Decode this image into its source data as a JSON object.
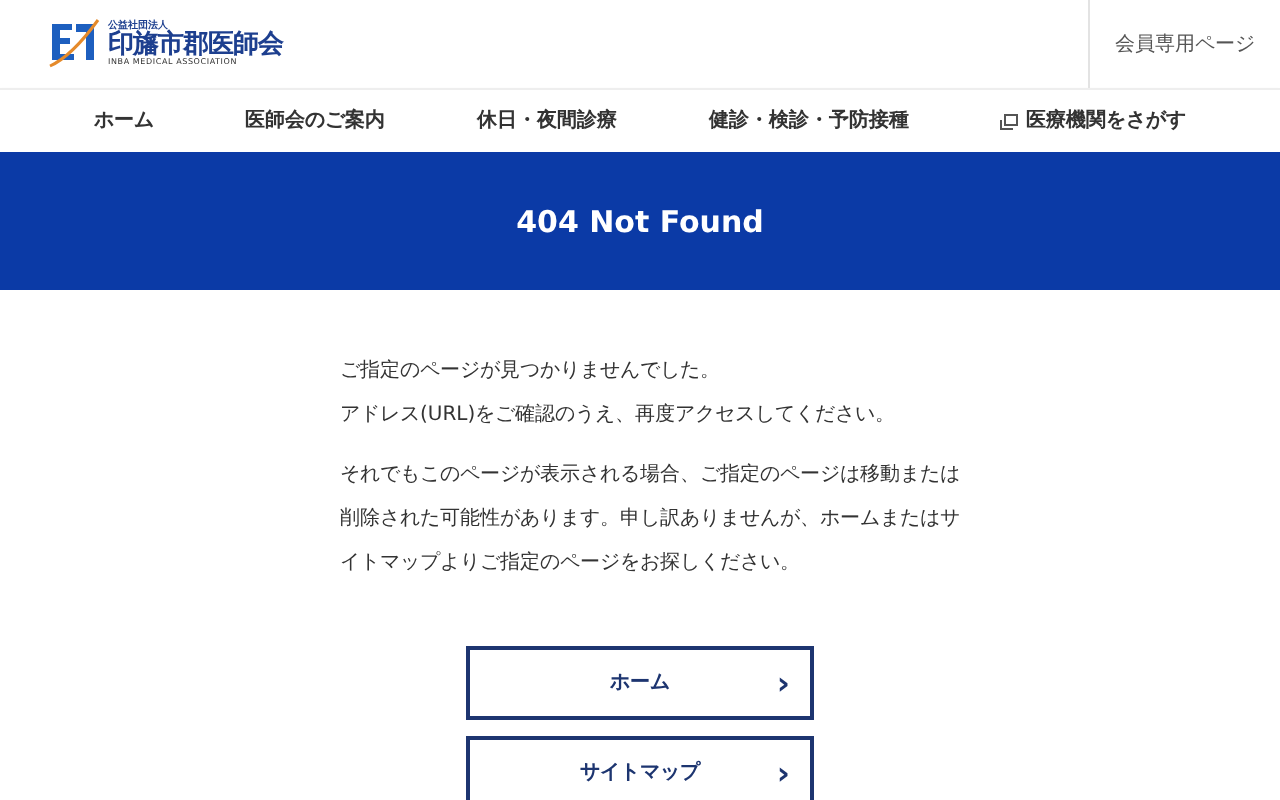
{
  "header": {
    "logo": {
      "corp": "公益社団法人",
      "name": "印旛市郡医師会",
      "english": "INBA MEDICAL ASSOCIATION"
    },
    "member_link": "会員専用ページ"
  },
  "nav": [
    {
      "label": "ホーム",
      "kind": "plain"
    },
    {
      "label": "医師会のご案内",
      "kind": "plain"
    },
    {
      "label": "休日・夜間診療",
      "kind": "plain"
    },
    {
      "label": "健診・検診・予防接種",
      "kind": "plain"
    },
    {
      "label": "医療機関をさがす",
      "kind": "external"
    }
  ],
  "banner": {
    "title": "404 Not Found"
  },
  "message": {
    "paragraphs": [
      "ご指定のページが見つかりませんでした。",
      "アドレス(URL)をご確認のうえ、再度アクセスしてください。",
      "それでもこのページが表示される場合、ご指定のページは移動または削除された可能性があります。申し訳ありませんが、ホームまたはサイトマップよりご指定のページをお探しください。"
    ]
  },
  "buttons": [
    {
      "label": "ホーム",
      "arrow": "›"
    },
    {
      "label": "サイトマップ",
      "arrow": "›"
    }
  ]
}
